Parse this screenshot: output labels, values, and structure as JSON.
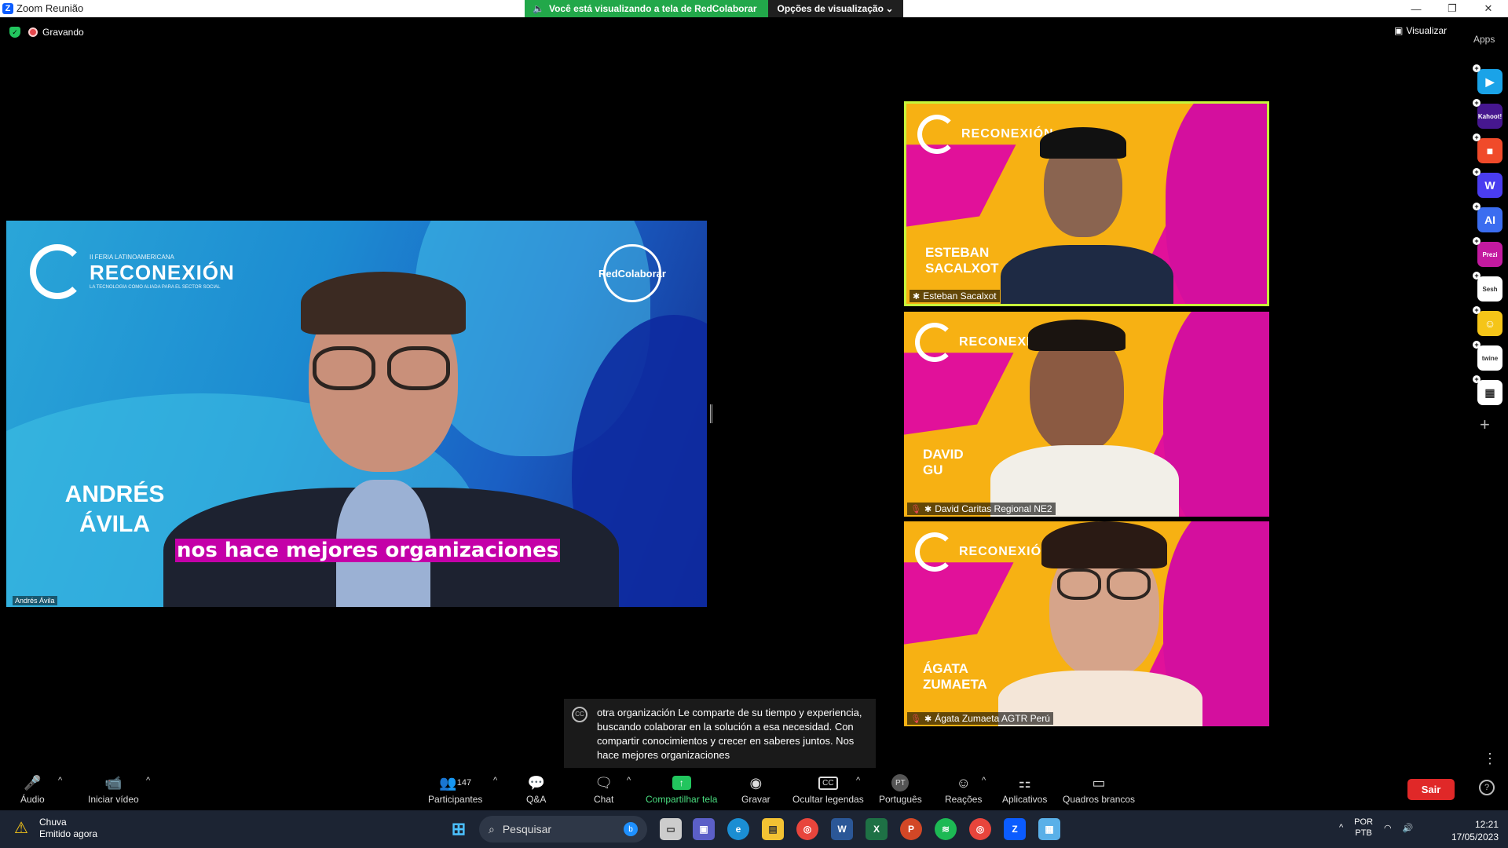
{
  "window": {
    "title": "Zoom Reunião",
    "viewing_banner": "Você está visualizando a tela de RedColaborar",
    "view_options": "Opções de visualização",
    "recording_label": "Gravando",
    "visualizar_label": "Visualizar",
    "apps_label": "Apps"
  },
  "main_speaker": {
    "name_graphic": [
      "ANDRÉS",
      "ÁVILA"
    ],
    "subtitle": "nos hace mejores organizaciones",
    "tag": "Andrés Ávila",
    "event_kicker": "II FERIA LATINOAMERICANA",
    "event_title": "RECONEXIÓN",
    "event_tagline": "LA TECNOLOGÍA COMO ALIADA PARA EL SECTOR SOCIAL",
    "brand": "RedColaborar"
  },
  "gallery": [
    {
      "graphic_name": [
        "ESTEBAN",
        "SACALXOT"
      ],
      "label": "Esteban Sacalxot",
      "muted": false,
      "active": true
    },
    {
      "graphic_name": [
        "DAVID",
        "GU"
      ],
      "label": "David Caritas Regional NE2",
      "muted": true,
      "active": false
    },
    {
      "graphic_name": [
        "ÁGATA",
        "ZUMAETA"
      ],
      "label": "Ágata Zumaeta AGTR Perú",
      "muted": true,
      "active": false
    }
  ],
  "side_apps": [
    {
      "name": "polls-app",
      "text": "▶",
      "color": "#1aa3e8"
    },
    {
      "name": "kahoot-app",
      "text": "Kahoot!",
      "color": "#46178f"
    },
    {
      "name": "red-app",
      "text": "■",
      "color": "#f04a2a"
    },
    {
      "name": "wordwall-app",
      "text": "W",
      "color": "#4a3df0"
    },
    {
      "name": "ai-app",
      "text": "AI",
      "color": "#3b6df0"
    },
    {
      "name": "prezi-app",
      "text": "Prezi",
      "color": "#c41aa0"
    },
    {
      "name": "sesh-app",
      "text": "Sesh",
      "color": "#ffffff"
    },
    {
      "name": "emoji-app",
      "text": "☺",
      "color": "#f5c518"
    },
    {
      "name": "twine-app",
      "text": "twine",
      "color": "#ffffff"
    },
    {
      "name": "grid-app",
      "text": "▦",
      "color": "#ffffff"
    }
  ],
  "captions": {
    "text": "otra organización Le comparte de su tiempo y experiencia, buscando colaborar en la solución a esa necesidad. Con compartir conocimientos y crecer en saberes juntos. Nos hace mejores organizaciones"
  },
  "toolbar": {
    "audio": "Áudio",
    "video": "Iniciar vídeo",
    "participants": "Participantes",
    "participants_count": "147",
    "qa": "Q&A",
    "chat": "Chat",
    "share": "Compartilhar tela",
    "record": "Gravar",
    "captions": "Ocultar legendas",
    "language": "Português",
    "language_badge": "PT",
    "reactions": "Reações",
    "apps": "Aplicativos",
    "whiteboards": "Quadros brancos",
    "leave": "Sair"
  },
  "taskbar": {
    "weather_title": "Chuva",
    "weather_sub": "Emitido agora",
    "search_placeholder": "Pesquisar",
    "lang_top": "POR",
    "lang_bottom": "PTB",
    "time": "12:21",
    "date": "17/05/2023"
  }
}
